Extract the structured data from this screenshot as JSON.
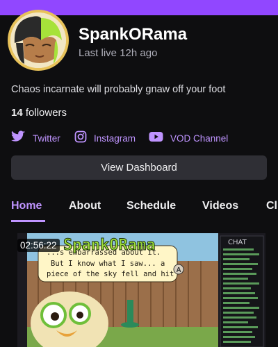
{
  "channel": {
    "name": "SpankORama",
    "last_live": "Last live 12h ago",
    "bio": "Chaos incarnate will probably gnaw off your foot",
    "followers_count": "14",
    "followers_label": "followers"
  },
  "social": {
    "twitter": "Twitter",
    "instagram": "Instagram",
    "vod": "VOD Channel"
  },
  "actions": {
    "dashboard": "View Dashboard"
  },
  "tabs": [
    {
      "label": "Home",
      "active": true
    },
    {
      "label": "About",
      "active": false
    },
    {
      "label": "Schedule",
      "active": false
    },
    {
      "label": "Videos",
      "active": false
    },
    {
      "label": "Cl",
      "active": false
    }
  ],
  "video": {
    "duration": "02:56:22",
    "overlay_title": "SpankORama",
    "subtitle_lines": [
      "...s embarrassed about it.",
      "But I know what I saw... a",
      "piece of the sky fell and hit"
    ],
    "chat_label": "CHAT"
  },
  "colors": {
    "accent": "#9147ff",
    "link": "#bf94ff",
    "background": "#0e0e10",
    "button": "#2f2f35"
  }
}
